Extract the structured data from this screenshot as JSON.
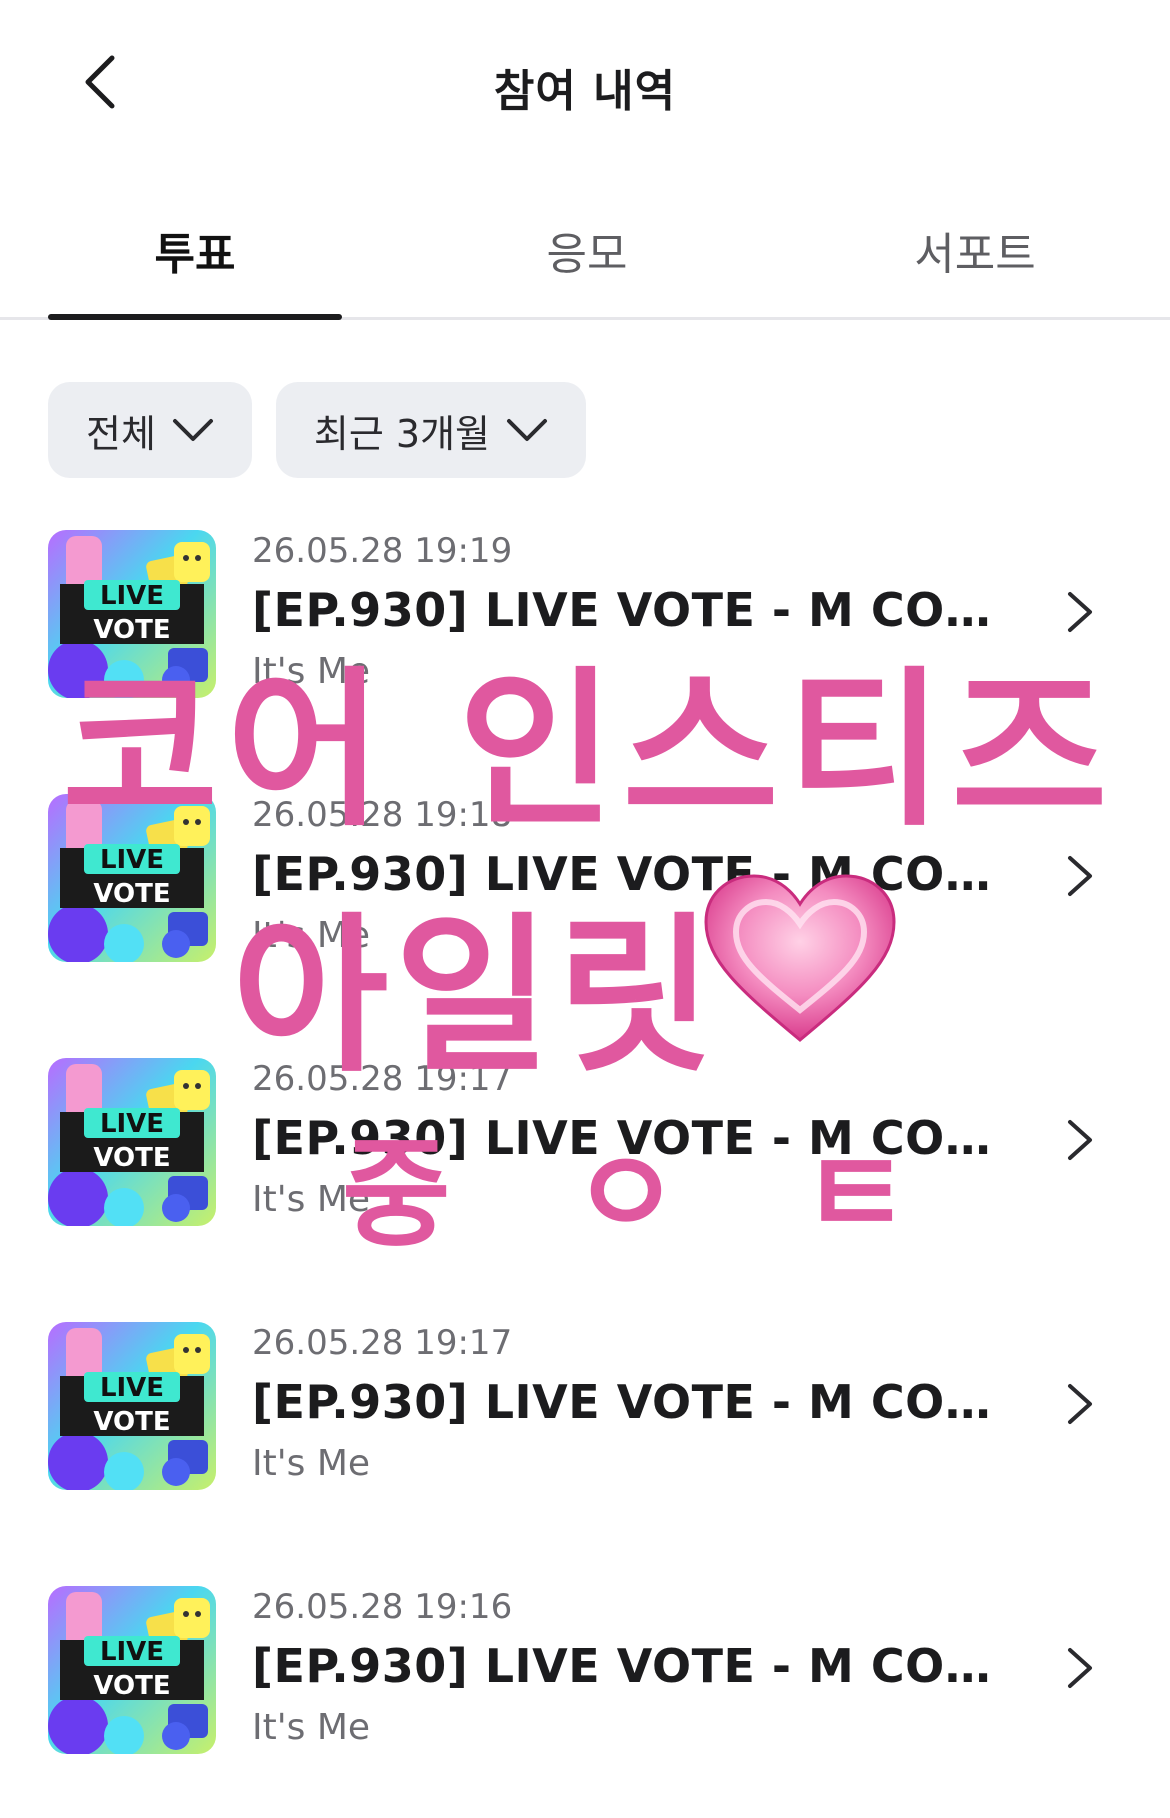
{
  "header": {
    "title": "참여 내역",
    "back_icon": "chevron-left-icon"
  },
  "tabs": [
    {
      "label": "투표",
      "active": true
    },
    {
      "label": "응모",
      "active": false
    },
    {
      "label": "서포트",
      "active": false
    }
  ],
  "filters": [
    {
      "label": "전체",
      "icon": "chevron-down-icon"
    },
    {
      "label": "최근 3개월",
      "icon": "chevron-down-icon"
    }
  ],
  "items": [
    {
      "date": "26.05.28 19:19",
      "title": "[EP.930] LIVE VOTE - M COUN...",
      "artist": "It's Me",
      "thumb_line1": "LIVE",
      "thumb_line2": "VOTE"
    },
    {
      "date": "26.05.28 19:18",
      "title": "[EP.930] LIVE VOTE - M COUN...",
      "artist": "It's Me",
      "thumb_line1": "LIVE",
      "thumb_line2": "VOTE"
    },
    {
      "date": "26.05.28 19:17",
      "title": "[EP.930] LIVE VOTE - M COUN...",
      "artist": "It's Me",
      "thumb_line1": "LIVE",
      "thumb_line2": "VOTE"
    },
    {
      "date": "26.05.28 19:17",
      "title": "[EP.930] LIVE VOTE - M COUN...",
      "artist": "It's Me",
      "thumb_line1": "LIVE",
      "thumb_line2": "VOTE"
    },
    {
      "date": "26.05.28 19:16",
      "title": "[EP.930] LIVE VOTE - M COUN...",
      "artist": "It's Me",
      "thumb_line1": "LIVE",
      "thumb_line2": "VOTE"
    }
  ],
  "overlay": {
    "line1": "코어 인스티즈",
    "line2": "아일릿",
    "line3": "중 ㅇ ㅌ",
    "heart_icon": "pink-heart-icon",
    "color": "#e0589f"
  }
}
